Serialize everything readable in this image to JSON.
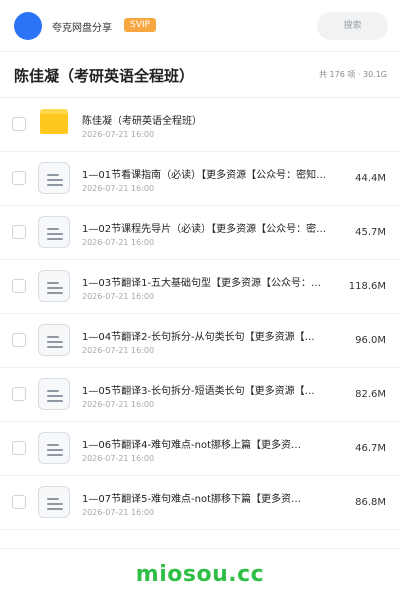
{
  "header": {
    "site_name": "夸克网盘分享",
    "badge": "SVIP",
    "search_placeholder": "搜索"
  },
  "title_row": {
    "title": "陈佳凝（考研英语全程班）",
    "summary": "共 176 项 · 30.1G"
  },
  "folder": {
    "name": "陈佳凝（考研英语全程班）",
    "date": "2026-07-21 16:00"
  },
  "files": [
    {
      "name": "1—01节看课指南（必读）【更多资源【公众号：密知…",
      "date": "2026-07-21 16:00",
      "size": "44.4M"
    },
    {
      "name": "1—02节课程先导片（必读）【更多资源【公众号：密…",
      "date": "2026-07-21 16:00",
      "size": "45.7M"
    },
    {
      "name": "1—03节翻译1-五大基础句型【更多资源【公众号：…",
      "date": "2026-07-21 16:00",
      "size": "118.6M"
    },
    {
      "name": "1—04节翻译2-长句拆分-从句类长句【更多资源【…",
      "date": "2026-07-21 16:00",
      "size": "96.0M"
    },
    {
      "name": "1—05节翻译3-长句拆分-短语类长句【更多资源【…",
      "date": "2026-07-21 16:00",
      "size": "82.6M"
    },
    {
      "name": "1—06节翻译4-难句难点-not挪移上篇【更多资…",
      "date": "2026-07-21 16:00",
      "size": "46.7M"
    },
    {
      "name": "1—07节翻译5-难句难点-not挪移下篇【更多资…",
      "date": "2026-07-21 16:00",
      "size": "86.8M"
    }
  ],
  "watermark": "miosou.cc",
  "colors": {
    "avatar": "#2a74f5",
    "svip_badge": "#f7a740",
    "folder": "#ffc81e",
    "watermark": "#2fbf47"
  },
  "icons": {
    "folder": "folder-icon",
    "file": "document-icon"
  }
}
